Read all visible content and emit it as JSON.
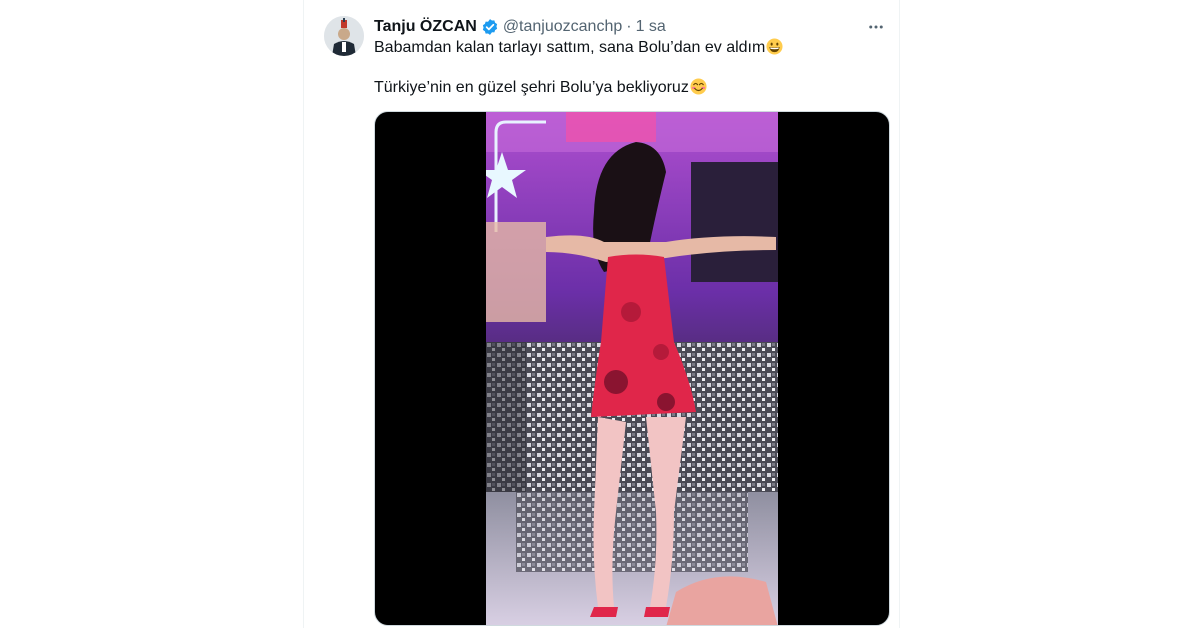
{
  "tweet": {
    "author": {
      "display_name": "Tanju ÖZCAN",
      "verified": true,
      "handle": "@tanjuozcanchp"
    },
    "separator": "·",
    "timestamp": "1 sa",
    "text_lines": [
      "Babamdan kalan tarlayı sattım, sana Bolu’dan ev aldım",
      "Türkiye’nin en güzel şehri Bolu’ya bekliyoruz"
    ],
    "emojis": [
      "grinning-face-emoji",
      "smiling-face-with-smiling-eyes-emoji"
    ],
    "media": {
      "type": "video",
      "description_icon": "video-thumbnail"
    }
  },
  "icons": {
    "verified": "verified-badge-icon",
    "more": "more-horizontal-icon"
  },
  "colors": {
    "text_primary": "#0f1419",
    "text_secondary": "#536471",
    "verified_blue": "#1d9bf0",
    "media_background": "#000000"
  }
}
